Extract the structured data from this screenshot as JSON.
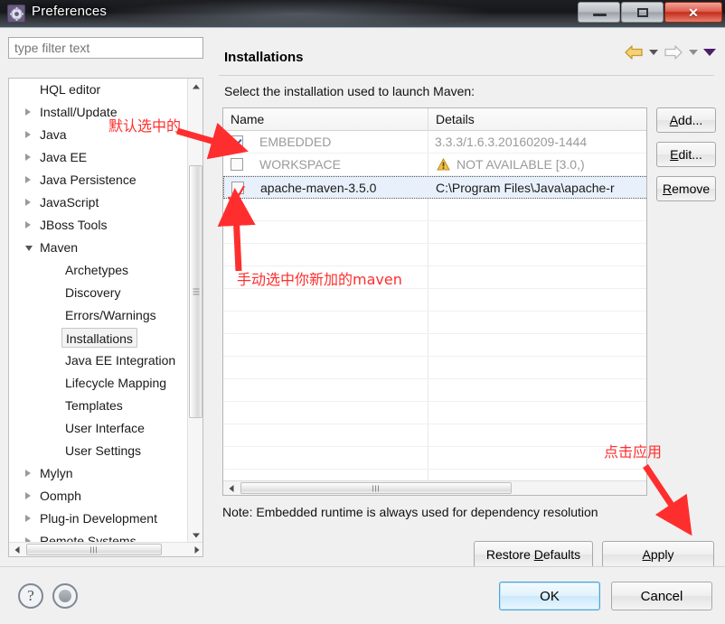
{
  "window": {
    "title": "Preferences",
    "icon": "gear-icon",
    "buttons": {
      "minimize": "minimize-icon",
      "maximize": "maximize-icon",
      "close": "✕"
    }
  },
  "sidebar": {
    "filter": {
      "placeholder": "type filter text",
      "value": ""
    },
    "items": [
      {
        "label": "HQL editor",
        "level": 0,
        "arrow": "none",
        "selected": false
      },
      {
        "label": "Install/Update",
        "level": 0,
        "arrow": "collapsed",
        "selected": false
      },
      {
        "label": "Java",
        "level": 0,
        "arrow": "collapsed",
        "selected": false
      },
      {
        "label": "Java EE",
        "level": 0,
        "arrow": "collapsed",
        "selected": false
      },
      {
        "label": "Java Persistence",
        "level": 0,
        "arrow": "collapsed",
        "selected": false
      },
      {
        "label": "JavaScript",
        "level": 0,
        "arrow": "collapsed",
        "selected": false
      },
      {
        "label": "JBoss Tools",
        "level": 0,
        "arrow": "collapsed",
        "selected": false
      },
      {
        "label": "Maven",
        "level": 0,
        "arrow": "expanded",
        "selected": false
      },
      {
        "label": "Archetypes",
        "level": 1,
        "arrow": "none",
        "selected": false
      },
      {
        "label": "Discovery",
        "level": 1,
        "arrow": "none",
        "selected": false
      },
      {
        "label": "Errors/Warnings",
        "level": 1,
        "arrow": "none",
        "selected": false
      },
      {
        "label": "Installations",
        "level": 1,
        "arrow": "none",
        "selected": true
      },
      {
        "label": "Java EE Integration",
        "level": 1,
        "arrow": "none",
        "selected": false
      },
      {
        "label": "Lifecycle Mapping",
        "level": 1,
        "arrow": "none",
        "selected": false
      },
      {
        "label": "Templates",
        "level": 1,
        "arrow": "none",
        "selected": false
      },
      {
        "label": "User Interface",
        "level": 1,
        "arrow": "none",
        "selected": false
      },
      {
        "label": "User Settings",
        "level": 1,
        "arrow": "none",
        "selected": false
      },
      {
        "label": "Mylyn",
        "level": 0,
        "arrow": "collapsed",
        "selected": false
      },
      {
        "label": "Oomph",
        "level": 0,
        "arrow": "collapsed",
        "selected": false
      },
      {
        "label": "Plug-in Development",
        "level": 0,
        "arrow": "collapsed",
        "selected": false
      },
      {
        "label": "Remote Systems",
        "level": 0,
        "arrow": "collapsed",
        "selected": false
      }
    ]
  },
  "page": {
    "title": "Installations",
    "subtitle": "Select the installation used to launch Maven:",
    "nav": {
      "back": "back-arrow-icon",
      "back_menu": "chevron-down-icon",
      "forward": "forward-arrow-icon",
      "forward_menu": "chevron-down-icon",
      "view_menu": "chevron-down-icon"
    },
    "table": {
      "columns": [
        "Name",
        "Details"
      ],
      "rows": [
        {
          "checked": true,
          "name": "EMBEDDED",
          "details": "3.3.3/1.6.3.20160209-1444",
          "warning": false,
          "selected": false
        },
        {
          "checked": false,
          "name": "WORKSPACE",
          "details": "NOT AVAILABLE [3.0,)",
          "warning": true,
          "selected": false
        },
        {
          "checked": false,
          "name": "apache-maven-3.5.0",
          "details": "C:\\Program Files\\Java\\apache-r",
          "warning": false,
          "selected": true
        }
      ]
    },
    "side_buttons": [
      {
        "label": "Add...",
        "mnemonic": "A"
      },
      {
        "label": "Edit...",
        "mnemonic": "E"
      },
      {
        "label": "Remove",
        "mnemonic": "R"
      }
    ],
    "note": "Note: Embedded runtime is always used for dependency resolution",
    "restore_defaults": "Restore Defaults",
    "restore_defaults_mnemonic": "D",
    "apply": "Apply",
    "apply_mnemonic": "A"
  },
  "footer": {
    "help_icon": "question-mark-icon",
    "dot_icon": "circle-dot-icon",
    "ok": "OK",
    "cancel": "Cancel"
  },
  "annotations": [
    {
      "text": "默认选中的",
      "id": "default-selected"
    },
    {
      "text": "手动选中你新加的maven",
      "id": "manually-select-new-maven"
    },
    {
      "text": "点击应用",
      "id": "click-apply"
    }
  ],
  "colors": {
    "annotation": "#ff2e2e",
    "selection": "#e8f1fb",
    "warning": "#e8a317",
    "back_arrow": "#f2c14b",
    "ok_border": "#4ea3d8"
  }
}
